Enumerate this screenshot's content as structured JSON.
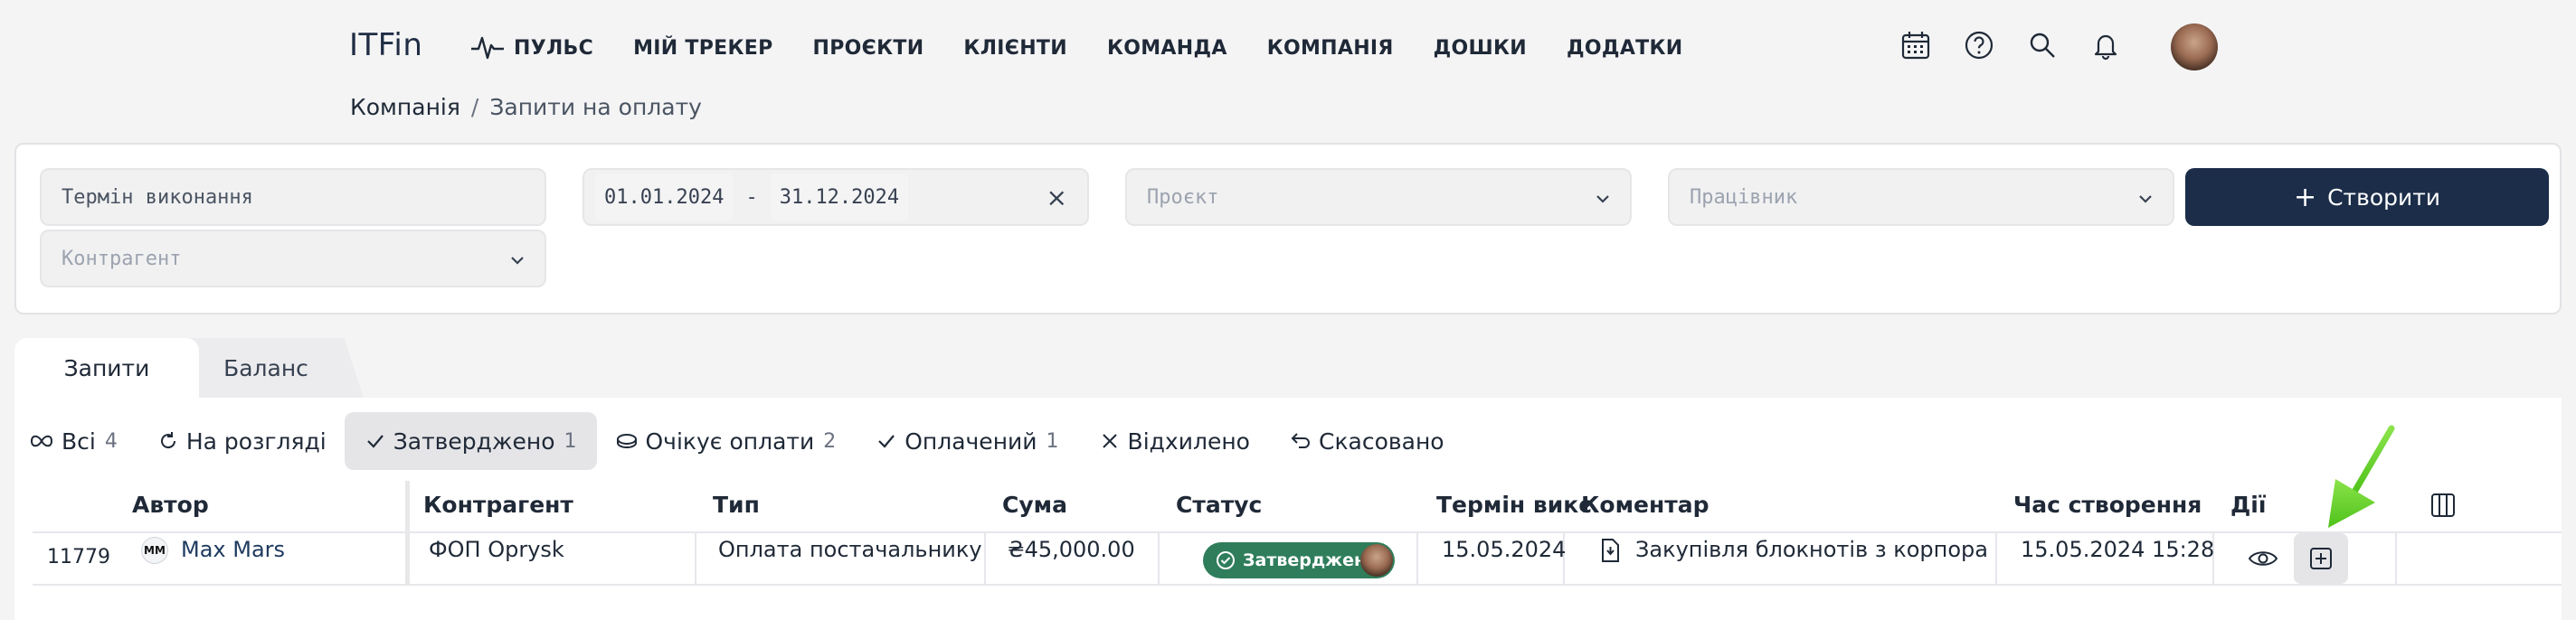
{
  "brand": {
    "logo": "ITFin"
  },
  "nav": {
    "items": [
      {
        "label": "Пульс"
      },
      {
        "label": "Мій трекер"
      },
      {
        "label": "Проєкти"
      },
      {
        "label": "Клієнти"
      },
      {
        "label": "Команда"
      },
      {
        "label": "Компанія"
      },
      {
        "label": "Дошки"
      },
      {
        "label": "Додатки"
      }
    ],
    "icons": [
      "calendar-icon",
      "help-icon",
      "search-icon",
      "bell-icon"
    ]
  },
  "breadcrumb": {
    "parent": "Компанія",
    "separator": "/",
    "current": "Запити на оплату"
  },
  "filters": {
    "due_date_placeholder": "Термін виконання",
    "date_from": "01.01.2024",
    "date_sep": "-",
    "date_to": "31.12.2024",
    "clear": "×",
    "project_placeholder": "Проєкт",
    "employee_placeholder": "Працівник",
    "counterparty_placeholder": "Контрагент",
    "create_label": "Створити",
    "create_plus": "+"
  },
  "tabs": [
    {
      "label": "Запити",
      "active": true
    },
    {
      "label": "Баланс",
      "active": false
    }
  ],
  "status_filters": [
    {
      "label": "Всі",
      "count": "4",
      "icon": "infinity-icon"
    },
    {
      "label": "На розгляді",
      "count": "",
      "icon": "refresh-icon"
    },
    {
      "label": "Затверджено",
      "count": "1",
      "icon": "check-icon",
      "active": true
    },
    {
      "label": "Очікує оплати",
      "count": "2",
      "icon": "coins-icon"
    },
    {
      "label": "Оплачений",
      "count": "1",
      "icon": "check-icon"
    },
    {
      "label": "Відхилено",
      "count": "",
      "icon": "x-icon"
    },
    {
      "label": "Скасовано",
      "count": "",
      "icon": "undo-icon"
    }
  ],
  "table": {
    "headers": {
      "author": "Автор",
      "counterparty": "Контрагент",
      "type": "Тип",
      "sum": "Сума",
      "status": "Статус",
      "due": "Термін викс",
      "comment": "Коментар",
      "created": "Час створення",
      "actions": "Дії"
    },
    "rows": [
      {
        "id": "11779",
        "author_initials": "MM",
        "author": "Max Mars",
        "counterparty": "ФОП Oprysk",
        "type": "Оплата постачальнику",
        "sum": "₴45,000.00",
        "status": "Затверджено",
        "due": "15.05.2024",
        "comment": "Закупівля блокнотів з корпорат",
        "created": "15.05.2024 15:28"
      }
    ]
  },
  "colors": {
    "primary": "#1b2d49",
    "approved": "#2f7d5b",
    "arrow": "#6ad62a"
  }
}
